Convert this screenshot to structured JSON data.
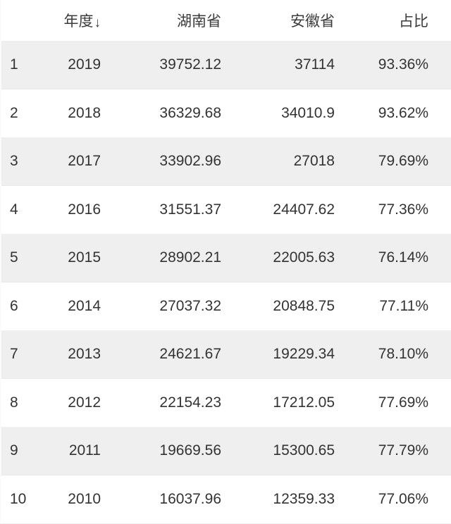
{
  "table": {
    "columns": [
      {
        "key": "index",
        "label": "",
        "align": "left"
      },
      {
        "key": "year",
        "label": "年度",
        "align": "right",
        "sort": "desc",
        "sort_glyph": "↓"
      },
      {
        "key": "hunan",
        "label": "湖南省",
        "align": "right"
      },
      {
        "key": "anhui",
        "label": "安徽省",
        "align": "right"
      },
      {
        "key": "ratio",
        "label": "占比",
        "align": "right"
      }
    ],
    "rows": [
      {
        "index": "1",
        "year": "2019",
        "hunan": "39752.12",
        "anhui": "37114",
        "ratio": "93.36%"
      },
      {
        "index": "2",
        "year": "2018",
        "hunan": "36329.68",
        "anhui": "34010.9",
        "ratio": "93.62%"
      },
      {
        "index": "3",
        "year": "2017",
        "hunan": "33902.96",
        "anhui": "27018",
        "ratio": "79.69%"
      },
      {
        "index": "4",
        "year": "2016",
        "hunan": "31551.37",
        "anhui": "24407.62",
        "ratio": "77.36%"
      },
      {
        "index": "5",
        "year": "2015",
        "hunan": "28902.21",
        "anhui": "22005.63",
        "ratio": "76.14%"
      },
      {
        "index": "6",
        "year": "2014",
        "hunan": "27037.32",
        "anhui": "20848.75",
        "ratio": "77.11%"
      },
      {
        "index": "7",
        "year": "2013",
        "hunan": "24621.67",
        "anhui": "19229.34",
        "ratio": "78.10%"
      },
      {
        "index": "8",
        "year": "2012",
        "hunan": "22154.23",
        "anhui": "17212.05",
        "ratio": "77.69%"
      },
      {
        "index": "9",
        "year": "2011",
        "hunan": "19669.56",
        "anhui": "15300.65",
        "ratio": "77.79%"
      },
      {
        "index": "10",
        "year": "2010",
        "hunan": "16037.96",
        "anhui": "12359.33",
        "ratio": "77.06%"
      }
    ]
  },
  "colors": {
    "page_background": "#ffffff",
    "row_stripe": "#efefef",
    "text": "#333333",
    "header_text": "#3b3b3b",
    "row_divider": "#f1f1f1"
  }
}
